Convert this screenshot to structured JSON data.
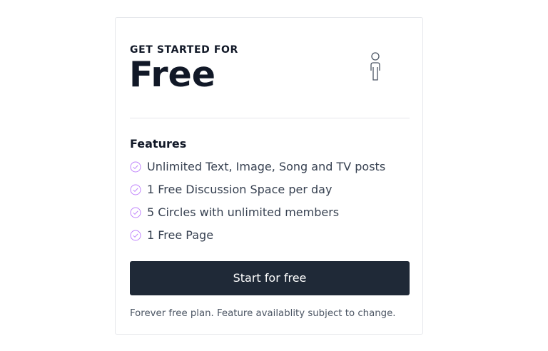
{
  "plan": {
    "eyebrow": "GET STARTED FOR",
    "price": "Free",
    "icon": "person-icon"
  },
  "features": {
    "title": "Features",
    "icon": "check-circle-icon",
    "items": [
      {
        "label": "Unlimited Text, Image, Song and TV posts"
      },
      {
        "label": "1 Free Discussion Space per day"
      },
      {
        "label": "5 Circles with unlimited members"
      },
      {
        "label": "1 Free Page"
      }
    ]
  },
  "cta": {
    "label": "Start for free"
  },
  "footer": {
    "note": "Forever free plan. Feature availablity subject to change."
  },
  "colors": {
    "button_bg": "#1f2937",
    "check": "#c084fc",
    "border": "#e5e7eb",
    "text_dark": "#111827",
    "text_muted": "#4b5563"
  }
}
